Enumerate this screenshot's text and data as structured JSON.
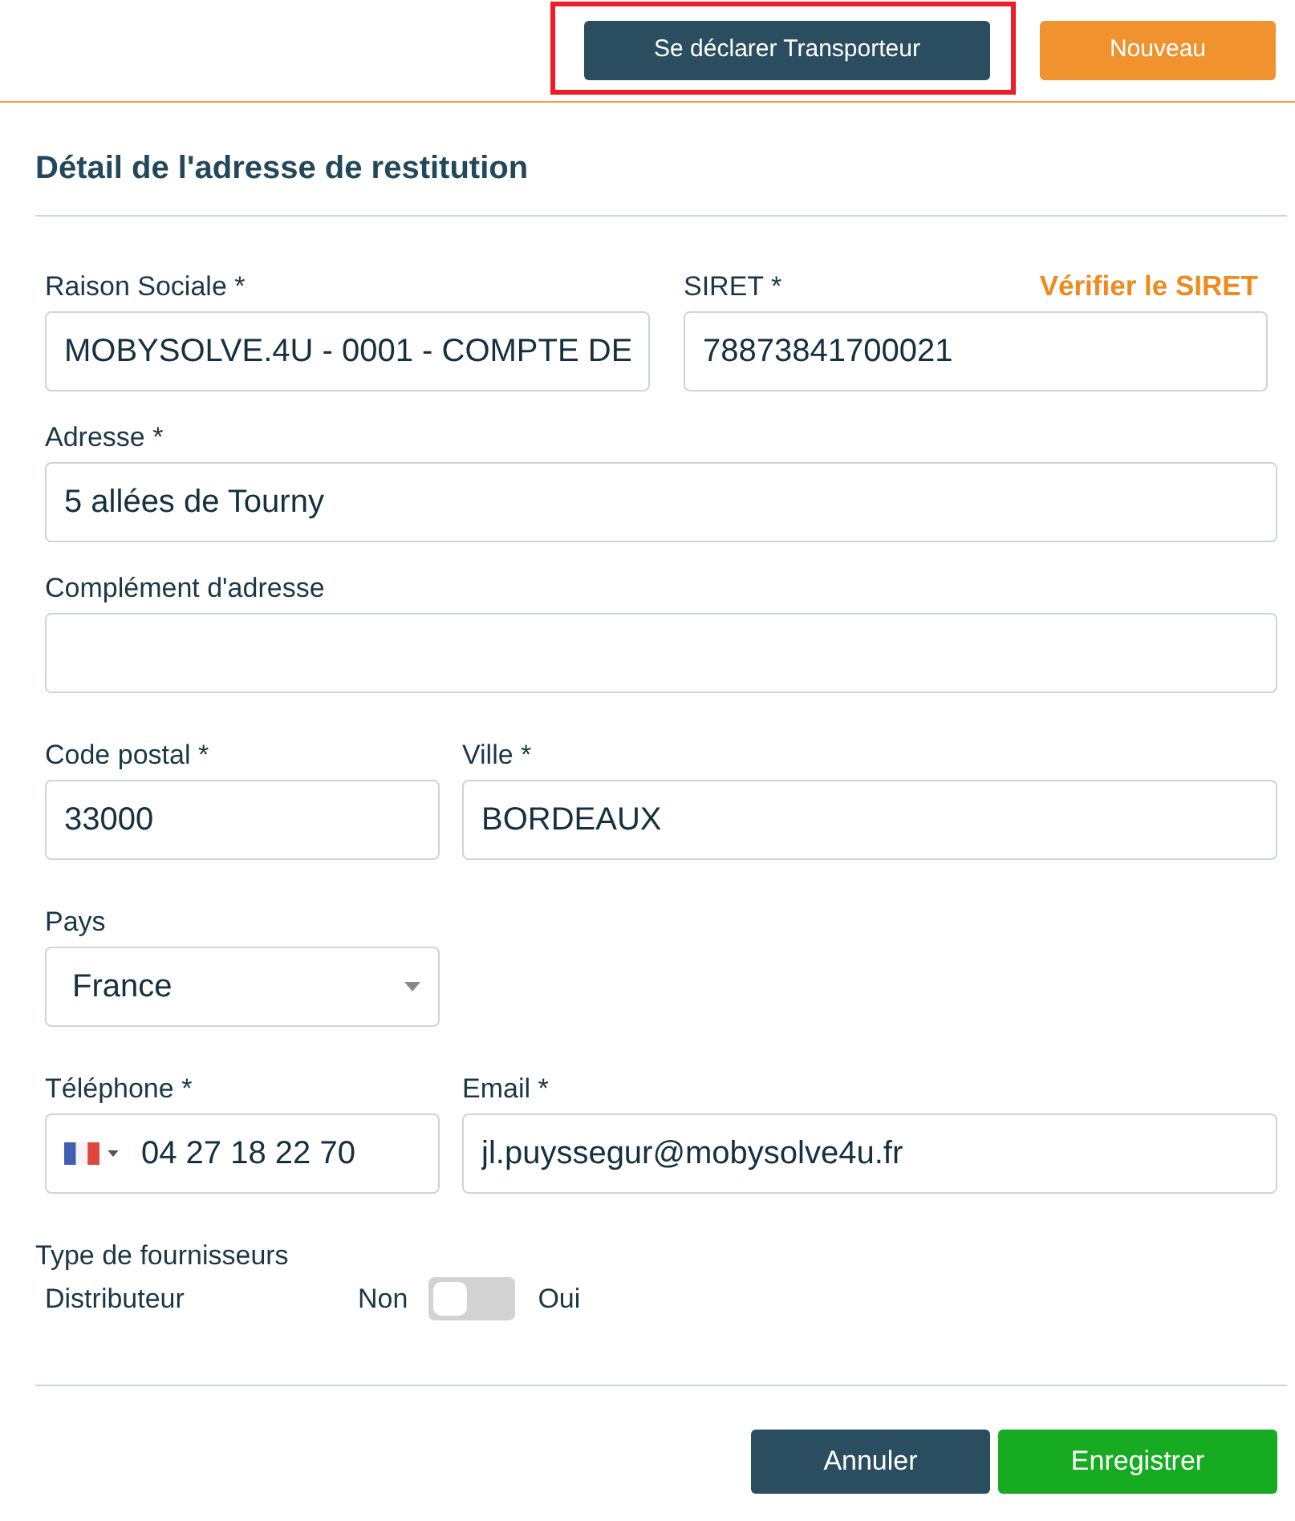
{
  "toolbar": {
    "buttons": [
      {
        "label": "Se déclarer Transporteur",
        "kind": "primary",
        "highlighted": true
      },
      {
        "label": "Nouveau",
        "kind": "accent",
        "highlighted": false
      }
    ]
  },
  "section_title": "Détail de l'adresse de restitution",
  "form": {
    "rows": [
      [
        {
          "kind": "text",
          "label": "Raison Sociale *",
          "value": "MOBYSOLVE.4U - 0001 - COMPTE DE"
        },
        {
          "kind": "text",
          "label": "SIRET *",
          "value": "78873841700021",
          "link": "Vérifier le SIRET"
        }
      ],
      [
        {
          "kind": "text",
          "label": "Adresse *",
          "value": "5 allées de Tourny"
        }
      ],
      [
        {
          "kind": "text",
          "label": "Complément d'adresse"
        }
      ],
      [
        {
          "kind": "text",
          "label": "Code postal *",
          "value": "33000"
        },
        {
          "kind": "text",
          "label": "Ville *",
          "value": "BORDEAUX"
        }
      ],
      [
        {
          "kind": "select",
          "label": "Pays",
          "value": "France"
        }
      ],
      [
        {
          "kind": "phone",
          "label": "Téléphone *",
          "value": "04 27 18 22 70"
        },
        {
          "kind": "text",
          "label": "Email *",
          "value": "jl.puyssegur@mobysolve4u.fr"
        }
      ]
    ]
  },
  "supplier_types": {
    "title": "Type de fournisseurs",
    "items": [
      {
        "label": "Distributeur",
        "off_label": "Non",
        "on_label": "Oui",
        "on": false
      }
    ]
  },
  "footer": {
    "buttons": [
      {
        "label": "Annuler",
        "kind": "secondary"
      },
      {
        "label": "Enregistrer",
        "kind": "success"
      }
    ]
  }
}
